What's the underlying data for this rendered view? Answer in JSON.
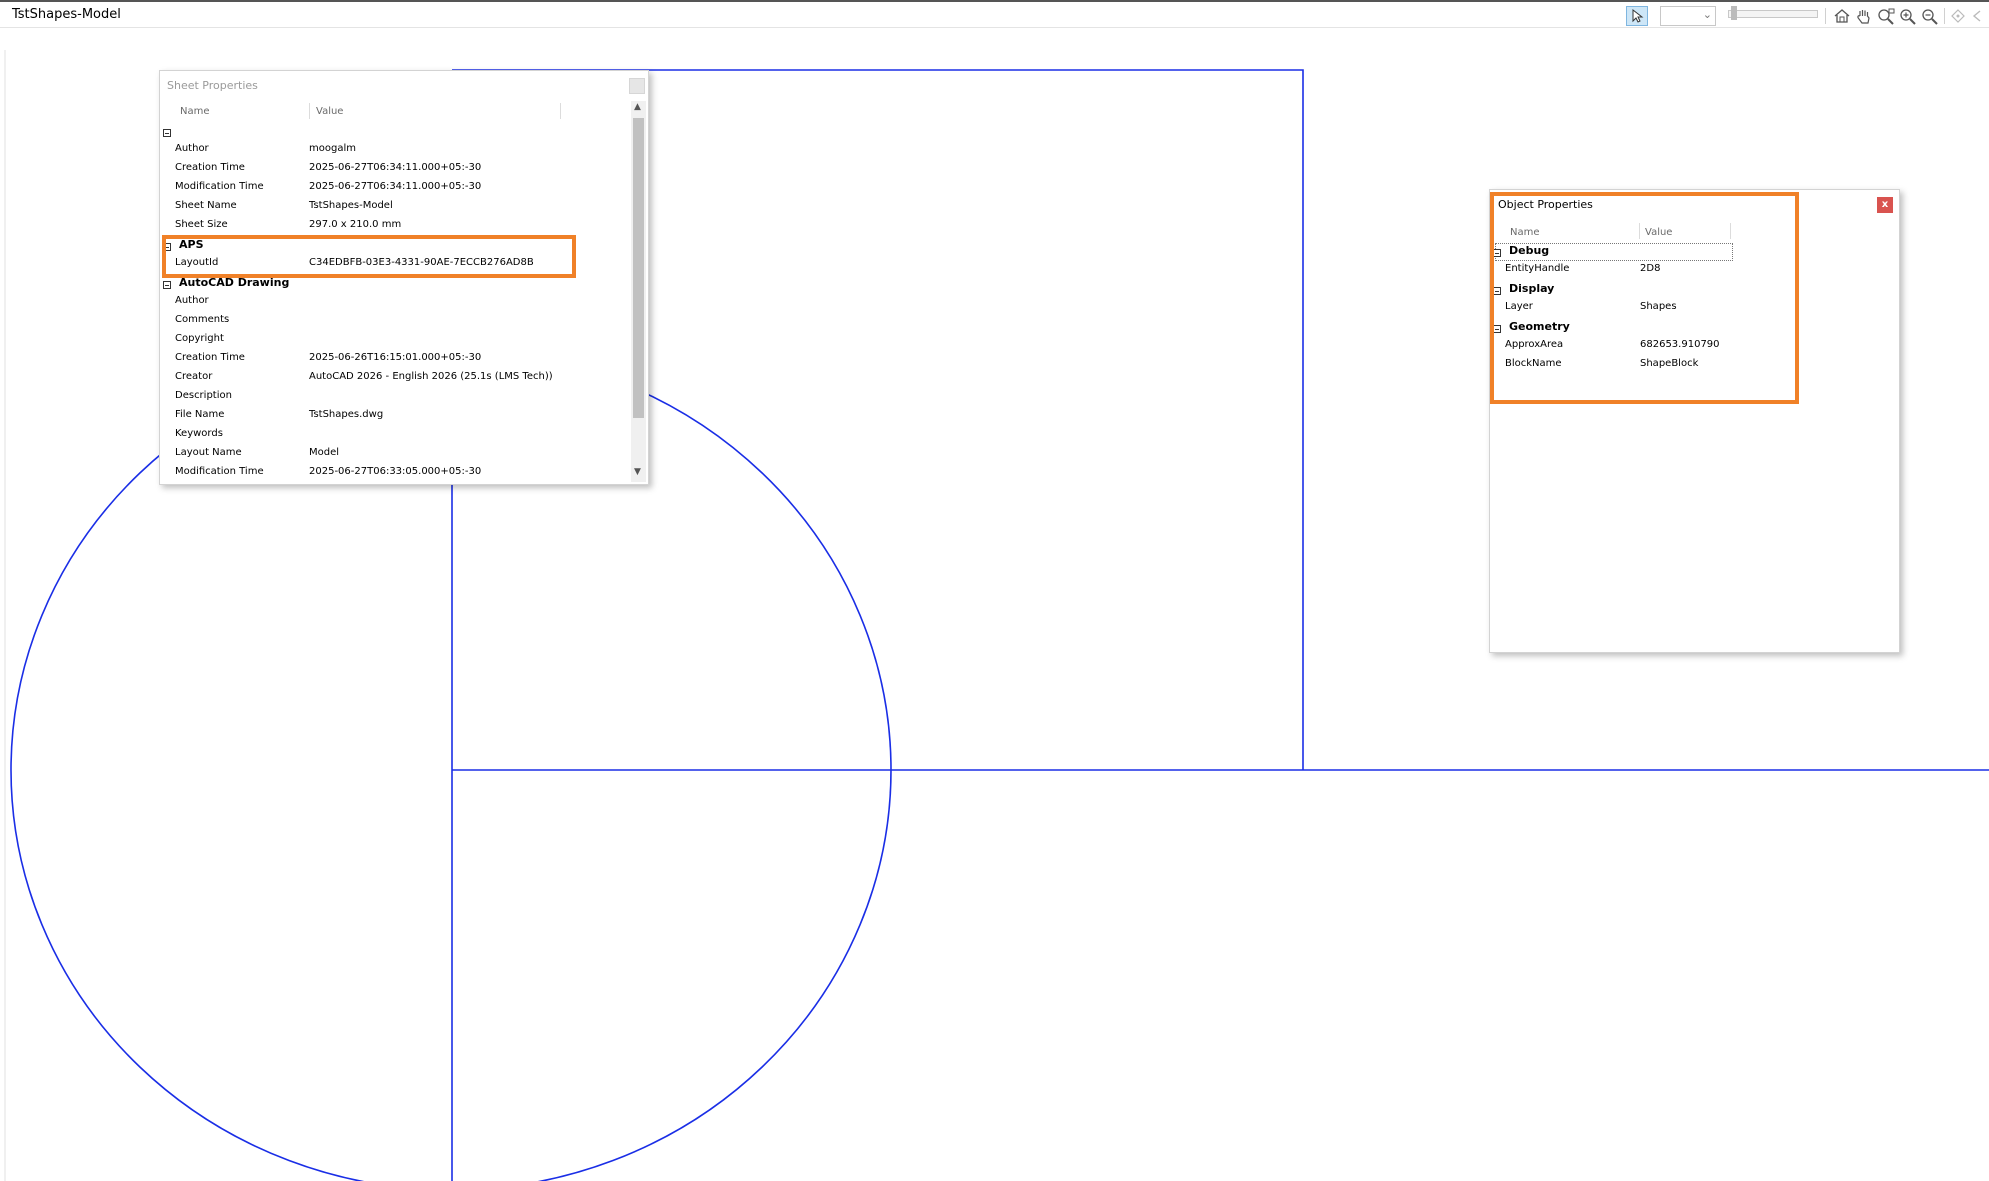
{
  "window": {
    "title": "TstShapes-Model"
  },
  "toolbar": {
    "icons": [
      "select-arrow-icon",
      "home-icon",
      "pan-hand-icon",
      "zoom-window-icon",
      "zoom-in-icon",
      "zoom-out-icon",
      "orbit-icon",
      "previous-icon"
    ]
  },
  "sheet_properties": {
    "title": "Sheet Properties",
    "col_name": "Name",
    "col_value": "Value",
    "general": [
      {
        "name": "Author",
        "value": "moogalm"
      },
      {
        "name": "Creation Time",
        "value": "2025-06-27T06:34:11.000+05:-30"
      },
      {
        "name": "Modification Time",
        "value": "2025-06-27T06:34:11.000+05:-30"
      },
      {
        "name": "Sheet Name",
        "value": "TstShapes-Model"
      },
      {
        "name": "Sheet Size",
        "value": "297.0 x 210.0 mm"
      }
    ],
    "aps": {
      "label": "APS",
      "rows": [
        {
          "name": "LayoutId",
          "value": "C34EDBFB-03E3-4331-90AE-7ECCB276AD8B"
        }
      ]
    },
    "autocad": {
      "label": "AutoCAD Drawing",
      "rows": [
        {
          "name": "Author",
          "value": ""
        },
        {
          "name": "Comments",
          "value": ""
        },
        {
          "name": "Copyright",
          "value": ""
        },
        {
          "name": "Creation Time",
          "value": "2025-06-26T16:15:01.000+05:-30"
        },
        {
          "name": "Creator",
          "value": "AutoCAD 2026 - English 2026 (25.1s (LMS Tech))"
        },
        {
          "name": "Description",
          "value": ""
        },
        {
          "name": "File Name",
          "value": "TstShapes.dwg"
        },
        {
          "name": "Keywords",
          "value": ""
        },
        {
          "name": "Layout Name",
          "value": "Model"
        },
        {
          "name": "Modification Time",
          "value": "2025-06-27T06:33:05.000+05:-30"
        }
      ]
    }
  },
  "object_properties": {
    "title": "Object Properties",
    "close_label": "x",
    "col_name": "Name",
    "col_value": "Value",
    "categories": [
      {
        "label": "Debug",
        "rows": [
          {
            "name": "EntityHandle",
            "value": "2D8"
          }
        ]
      },
      {
        "label": "Display",
        "rows": [
          {
            "name": "Layer",
            "value": "Shapes"
          }
        ]
      },
      {
        "label": "Geometry",
        "rows": [
          {
            "name": "ApproxArea",
            "value": "682653.910790"
          },
          {
            "name": "BlockName",
            "value": "ShapeBlock"
          }
        ]
      }
    ]
  },
  "colors": {
    "drawing_lines": "#1a2ee6",
    "highlight_box": "#f08128",
    "close_button": "#d9534f"
  }
}
